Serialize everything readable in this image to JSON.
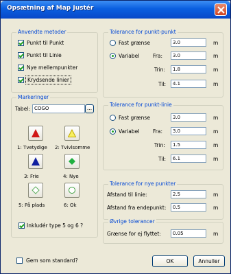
{
  "window": {
    "title": "Opsætning af Map Justér"
  },
  "methods": {
    "label": "Anvendte metoder",
    "items": [
      {
        "label": "Punkt til Punkt",
        "checked": true
      },
      {
        "label": "Punkt til Linie",
        "checked": true
      },
      {
        "label": "Nye mellempunkter",
        "checked": true
      },
      {
        "label": "Krydsende linier",
        "checked": true
      }
    ]
  },
  "markers": {
    "label": "Markeringer",
    "table_label": "Tabel:",
    "table_value": "COGO",
    "browse_label": "...",
    "types": [
      {
        "caption": "1: Tvetydige",
        "icon": "red-triangle-icon",
        "color": "#d01818"
      },
      {
        "caption": "2: Tvivlsomme",
        "icon": "yellow-triangle-icon",
        "color": "#e8d820"
      },
      {
        "caption": "3: Frie",
        "icon": "blue-triangle-icon",
        "color": "#1020a0"
      },
      {
        "caption": "4: Nye",
        "icon": "green-diamond-icon",
        "color": "#20b040"
      },
      {
        "caption": "5: På plads",
        "icon": "diamond-outline-icon",
        "color": "#60b060"
      },
      {
        "caption": "6: Ok",
        "icon": "circle-outline-icon",
        "color": "#40a040"
      }
    ],
    "include_label": "Inkludér type 5 og 6 ?",
    "include_checked": true
  },
  "point_point": {
    "label": "Tolerance for punkt-punkt",
    "fixed_label": "Fast grænse",
    "variable_label": "Variabel",
    "from_label": "Fra:",
    "from_value": "3.0",
    "fixed_value": "3.0",
    "step_label": "Trin:",
    "step_value": "1.8",
    "to_label": "Til:",
    "to_value": "4.1",
    "unit": "m"
  },
  "point_line": {
    "label": "Tolerance for punkt-linie",
    "fixed_label": "Fast grænse",
    "variable_label": "Variabel",
    "fixed_value": "3.0",
    "from_label": "Fra:",
    "from_value": "3.0",
    "step_label": "Trin:",
    "step_value": "1.5",
    "to_label": "Til:",
    "to_value": "6.1",
    "unit": "m"
  },
  "new_points": {
    "label": "Tolerance for nye punkter",
    "dist_line_label": "Afstand til linie:",
    "dist_line_value": "2.5",
    "dist_end_label": "Afstand fra endepunkt:",
    "dist_end_value": "0.5",
    "unit": "m"
  },
  "other": {
    "label": "Øvrige tolerancer",
    "moved_label": "Grænse for ej flyttet:",
    "moved_value": "0.05",
    "unit": "m"
  },
  "footer": {
    "save_default_label": "Gem som standard?",
    "save_default_checked": false,
    "ok_label": "OK",
    "cancel_label": "Annuller"
  }
}
